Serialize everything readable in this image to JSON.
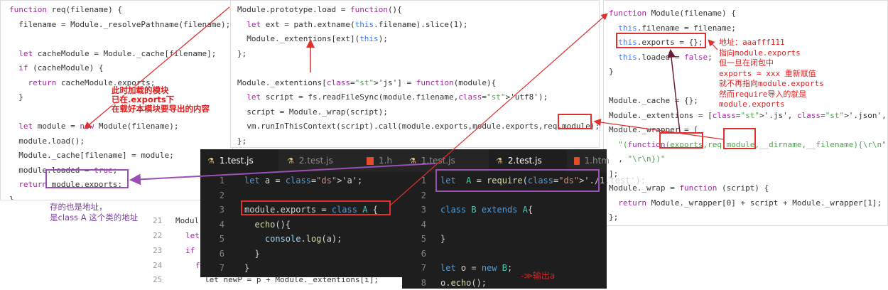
{
  "panel_left": {
    "lines": [
      {
        "t": "function req(filename) {"
      },
      {
        "t": "  filename = Module._resolvePathname(filename);"
      },
      {
        "t": ""
      },
      {
        "t": "  let cacheModule = Module._cache[filename];"
      },
      {
        "t": "  if (cacheModule) {"
      },
      {
        "t": "    return cacheModule.exports;"
      },
      {
        "t": "  }"
      },
      {
        "t": ""
      },
      {
        "t": "  let module = new Module(filename);"
      },
      {
        "t": "  module.load();"
      },
      {
        "t": "  Module._cache[filename] = module;"
      },
      {
        "t": "  module.loaded = true;"
      },
      {
        "t": "  return module.exports;"
      },
      {
        "t": "}"
      }
    ]
  },
  "panel_middle": {
    "lines": [
      {
        "t": "Module.prototype.load = function(){"
      },
      {
        "t": "  let ext = path.extname(this.filename).slice(1);"
      },
      {
        "t": "  Module._extentions[ext](this);"
      },
      {
        "t": "};"
      },
      {
        "t": ""
      },
      {
        "t": "Module._extentions['js'] = function(module){"
      },
      {
        "t": "  let script = fs.readFileSync(module.filename,'utf8');"
      },
      {
        "t": "  script = Module._wrap(script);"
      },
      {
        "t": "  vm.runInThisContext(script).call(module.exports,module.exports,req,module);"
      },
      {
        "t": "};"
      }
    ]
  },
  "panel_right": {
    "lines": [
      {
        "t": "function Module(filename) {"
      },
      {
        "t": "  this.filename = filename;"
      },
      {
        "t": "  this.exports = {};"
      },
      {
        "t": "  this.loaded = false;"
      },
      {
        "t": "}"
      },
      {
        "t": ""
      },
      {
        "t": "Module._cache = {};"
      },
      {
        "t": "Module._extentions = ['.js', '.json', '.node'];"
      },
      {
        "t": "Module._wrapper = ["
      },
      {
        "t": "  \"(function(exports,req,module,__dirname,__filename){\\r\\n\""
      },
      {
        "t": "  , \"\\r\\n})\""
      },
      {
        "t": "];"
      },
      {
        "t": "Module._wrap = function (script) {"
      },
      {
        "t": "  return Module._wrapper[0] + script + Module._wrapper[1];"
      },
      {
        "t": "};"
      }
    ]
  },
  "ghost_code": {
    "l1": "Modul",
    "l2": "let",
    "l3": "if",
    "l4": "f",
    "l5": "let newP = p + Module._extentions[i];",
    "n1": "21",
    "n2": "22",
    "n3": "23",
    "n4": "24",
    "n5": "25"
  },
  "editor1": {
    "tabs": [
      {
        "label": "1.test.js",
        "icon": "flask-icon",
        "active": true
      },
      {
        "label": "2.test.js",
        "icon": "flask-icon",
        "active": false
      },
      {
        "label": "1.h",
        "icon": "html5-icon",
        "active": false
      }
    ],
    "line_numbers": [
      "1",
      "2",
      "3",
      "4",
      "5",
      "6",
      "7"
    ],
    "lines": [
      "let a = 'a';",
      "",
      "module.exports = class A {",
      "  echo(){",
      "    console.log(a);",
      "  }",
      "}"
    ]
  },
  "editor2": {
    "tabs": [
      {
        "label": "1.test.js",
        "icon": "flask-icon",
        "active": false
      },
      {
        "label": "2.test.js",
        "icon": "flask-icon",
        "active": true
      },
      {
        "label": "1.htm",
        "icon": "html5-icon",
        "active": false
      }
    ],
    "line_numbers": [
      "1",
      "2",
      "3",
      "4",
      "5",
      "6",
      "7",
      "8"
    ],
    "lines": [
      "let  A = require('./1.test');",
      "",
      "class B extends A{",
      "",
      "}",
      "",
      "let o = new B;",
      "o.echo();"
    ]
  },
  "annotations": {
    "red_left": "此时加载的模块\n已在.exports下\n在载好本模块要导出的内容",
    "purple_left": "存的也是地址，\n是class A 这个类的地址",
    "red_right": "地址：aaafff111\n指向module.exports\n但一旦在闭包中\nexports = xxx 重新赋值\n就不再指向module.exports\n然而require导入的就是\nmodule.exports",
    "output": "-≫输出a"
  },
  "colors": {
    "red": "#e03030",
    "purple": "#9b4fb5",
    "editor_bg": "#1e1e1e"
  }
}
